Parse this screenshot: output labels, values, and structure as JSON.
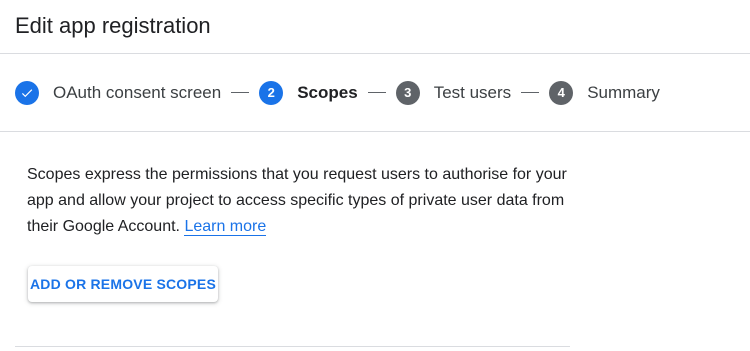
{
  "header": {
    "title": "Edit app registration"
  },
  "stepper": {
    "steps": [
      {
        "number": "",
        "label": "OAuth consent screen",
        "state": "completed",
        "icon": "check-icon"
      },
      {
        "number": "2",
        "label": "Scopes",
        "state": "active"
      },
      {
        "number": "3",
        "label": "Test users",
        "state": "pending"
      },
      {
        "number": "4",
        "label": "Summary",
        "state": "pending"
      }
    ]
  },
  "main": {
    "description": "Scopes express the permissions that you request users to authorise for your app and allow your project to access specific types of private user data from their Google Account.",
    "learn_more_label": "Learn more",
    "add_scopes_label": "ADD OR REMOVE SCOPES"
  },
  "colors": {
    "accent": "#1a73e8",
    "pending_step": "#5f6368",
    "divider": "#dadce0"
  }
}
